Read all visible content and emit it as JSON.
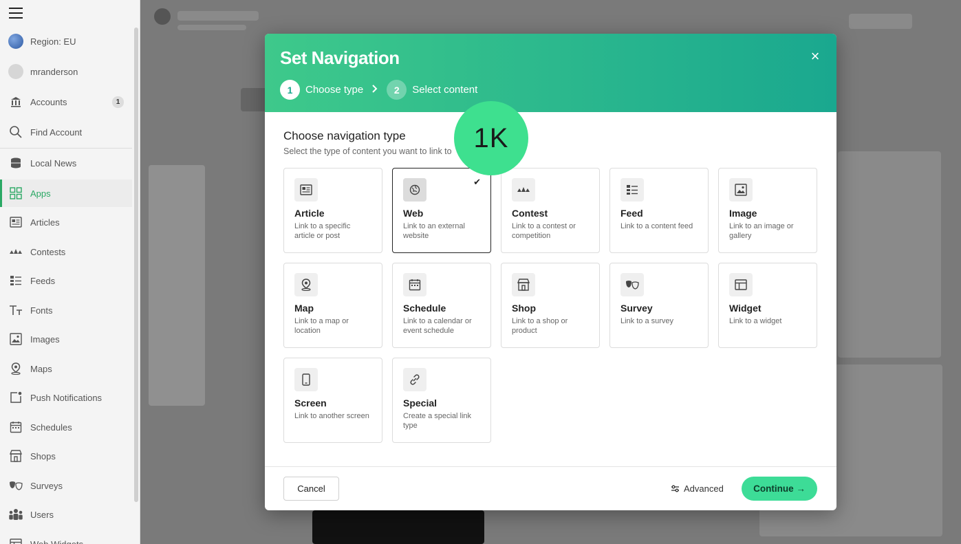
{
  "sidebar": {
    "items": [
      {
        "name": "sidebar-item-region",
        "label": "Region: EU",
        "icon": "globe-icon"
      },
      {
        "name": "sidebar-item-user",
        "label": "mranderson",
        "icon": "avatar-icon"
      },
      {
        "name": "sidebar-item-accounts",
        "label": "Accounts",
        "icon": "bank-icon",
        "badge": "1"
      },
      {
        "name": "sidebar-item-find-account",
        "label": "Find Account",
        "icon": "search-icon"
      },
      {
        "name": "sidebar-item-local-news",
        "label": "Local News",
        "icon": "database-icon"
      },
      {
        "name": "sidebar-item-apps",
        "label": "Apps",
        "icon": "grid-icon",
        "active": true
      },
      {
        "name": "sidebar-item-articles",
        "label": "Articles",
        "icon": "article-icon"
      },
      {
        "name": "sidebar-item-contests",
        "label": "Contests",
        "icon": "contest-icon"
      },
      {
        "name": "sidebar-item-feeds",
        "label": "Feeds",
        "icon": "feed-icon"
      },
      {
        "name": "sidebar-item-fonts",
        "label": "Fonts",
        "icon": "font-icon"
      },
      {
        "name": "sidebar-item-images",
        "label": "Images",
        "icon": "image-icon"
      },
      {
        "name": "sidebar-item-maps",
        "label": "Maps",
        "icon": "map-pin-icon"
      },
      {
        "name": "sidebar-item-push-notifications",
        "label": "Push Notifications",
        "icon": "notification-icon"
      },
      {
        "name": "sidebar-item-schedules",
        "label": "Schedules",
        "icon": "calendar-icon"
      },
      {
        "name": "sidebar-item-shops",
        "label": "Shops",
        "icon": "shop-icon"
      },
      {
        "name": "sidebar-item-surveys",
        "label": "Surveys",
        "icon": "survey-icon"
      },
      {
        "name": "sidebar-item-users",
        "label": "Users",
        "icon": "users-icon"
      },
      {
        "name": "sidebar-item-web-widgets",
        "label": "Web Widgets",
        "icon": "widget-icon"
      }
    ]
  },
  "modal": {
    "title": "Set Navigation",
    "close_label": "×",
    "steps": [
      {
        "number": "1",
        "label": "Choose type"
      },
      {
        "number": "2",
        "label": "Select content"
      }
    ],
    "section_title": "Choose navigation type",
    "section_subtitle": "Select the type of content you want to link to",
    "cards": [
      {
        "name": "article",
        "title": "Article",
        "desc": "Link to a specific article or post",
        "icon": "article-icon"
      },
      {
        "name": "web",
        "title": "Web",
        "desc": "Link to an external website",
        "icon": "globe-icon",
        "selected": true
      },
      {
        "name": "contest",
        "title": "Contest",
        "desc": "Link to a contest or competition",
        "icon": "contest-icon"
      },
      {
        "name": "feed",
        "title": "Feed",
        "desc": "Link to a content feed",
        "icon": "feed-icon"
      },
      {
        "name": "image",
        "title": "Image",
        "desc": "Link to an image or gallery",
        "icon": "image-icon"
      },
      {
        "name": "map",
        "title": "Map",
        "desc": "Link to a map or location",
        "icon": "map-pin-icon"
      },
      {
        "name": "schedule",
        "title": "Schedule",
        "desc": "Link to a calendar or event schedule",
        "icon": "calendar-icon"
      },
      {
        "name": "shop",
        "title": "Shop",
        "desc": "Link to a shop or product",
        "icon": "shop-icon"
      },
      {
        "name": "survey",
        "title": "Survey",
        "desc": "Link to a survey",
        "icon": "survey-icon"
      },
      {
        "name": "widget",
        "title": "Widget",
        "desc": "Link to a widget",
        "icon": "widget-icon"
      },
      {
        "name": "screen",
        "title": "Screen",
        "desc": "Link to another screen",
        "icon": "phone-icon"
      },
      {
        "name": "special",
        "title": "Special",
        "desc": "Create a special link type",
        "icon": "link-icon"
      }
    ],
    "selected_mark": "✔",
    "footer": {
      "cancel_label": "Cancel",
      "advanced_label": "Advanced",
      "continue_label": "Continue →"
    }
  },
  "overlay_bubble": "1K",
  "colors": {
    "accent": "#2aa864",
    "header_start": "#3ec98b",
    "header_end": "#1aa88f",
    "continue_button": "#3ddc97"
  }
}
